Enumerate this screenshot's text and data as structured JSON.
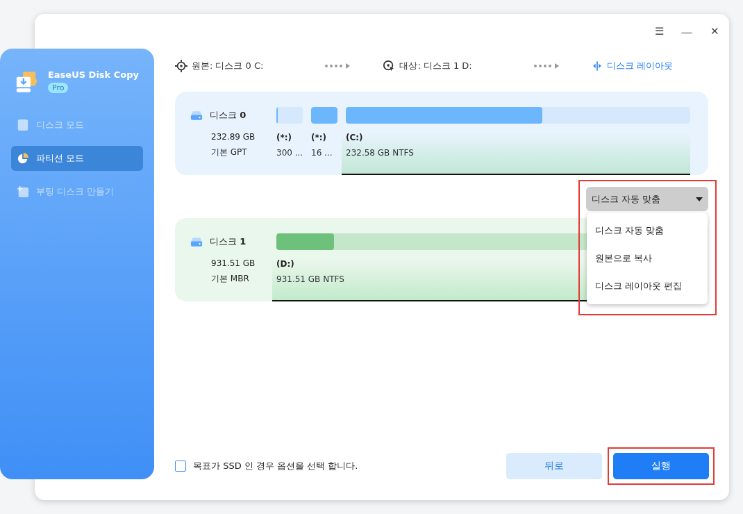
{
  "window_controls": {
    "menu": "☰",
    "minimize": "—",
    "close": "✕"
  },
  "sidebar": {
    "app_name": "EaseUS Disk Copy",
    "badge": "Pro",
    "items": [
      {
        "label": "디스크 모드",
        "selected": false,
        "disabled": true,
        "kind": "disk"
      },
      {
        "label": "파티션 모드",
        "selected": true,
        "disabled": false,
        "kind": "partition"
      },
      {
        "label": "부팅 디스크 만들기",
        "selected": false,
        "disabled": true,
        "kind": "boot"
      }
    ]
  },
  "steps": [
    {
      "kind": "source",
      "label": "원본:",
      "value": "디스크 0 C:",
      "active": false
    },
    {
      "kind": "target",
      "label": "대상:",
      "value": "디스크 1 D:",
      "active": false
    },
    {
      "kind": "layout",
      "label": "디스크 레이아웃",
      "active": true
    }
  ],
  "disks": [
    {
      "kind": "source",
      "name": "디스크 ",
      "number": "0",
      "size": "232.89 GB",
      "type": "기본 GPT",
      "partitions": [
        {
          "label": "(*:)",
          "detail": "300 ...",
          "level": 0.05,
          "selected": false
        },
        {
          "label": "(*:)",
          "detail": "16 ...",
          "level": 1,
          "selected": false
        },
        {
          "label": "(C:)",
          "detail": "232.58 GB NTFS",
          "level": 0.57,
          "selected": true
        }
      ]
    },
    {
      "kind": "target",
      "name": "디스크 ",
      "number": "1",
      "size": "931.51 GB",
      "type": "기본 MBR",
      "partitions": [
        {
          "label": "(D:)",
          "detail": "931.51 GB NTFS",
          "level": 0.14,
          "selected": true
        }
      ]
    }
  ],
  "layout_dropdown": {
    "value": "디스크 자동 맞춤",
    "expanded": true,
    "highlighted": true,
    "options": [
      "디스크 자동 맞춤",
      "원본으로 복사",
      "디스크 레이아웃 편집"
    ]
  },
  "ssd_option": {
    "label": "목표가 SSD 인 경우 옵션을 선택 합니다.",
    "checked": false
  },
  "buttons": [
    {
      "kind": "back",
      "label": "뒤로",
      "highlighted": false
    },
    {
      "kind": "run",
      "label": "실행",
      "highlighted": true
    }
  ]
}
